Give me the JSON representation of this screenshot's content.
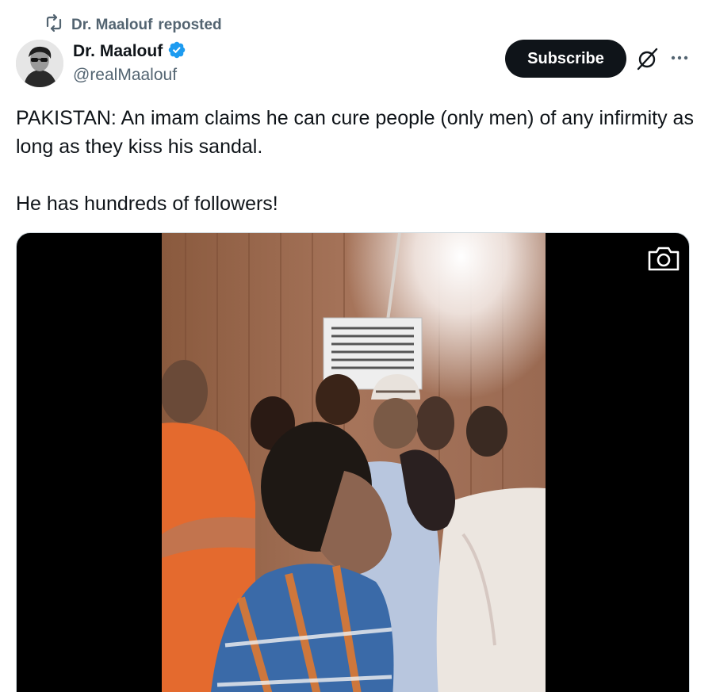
{
  "repost": {
    "icon": "repost-icon",
    "name": "Dr. Maalouf",
    "label": "reposted"
  },
  "author": {
    "display_name": "Dr. Maalouf",
    "handle": "@realMaalouf",
    "verified": true,
    "verified_color": "#1d9bf0"
  },
  "actions": {
    "subscribe_label": "Subscribe",
    "grok_icon": "grok-icon",
    "more_icon": "more-icon"
  },
  "tweet": {
    "paragraph_1": "PAKISTAN: An imam claims he can cure people (only men) of any infirmity as long as they kiss his sandal.",
    "paragraph_2": "He has hundreds of followers!"
  },
  "media": {
    "type": "video",
    "overlay_icon": "camera-icon"
  },
  "colors": {
    "text_primary": "#0f1419",
    "text_secondary": "#536471",
    "button_dark": "#0f1419"
  }
}
